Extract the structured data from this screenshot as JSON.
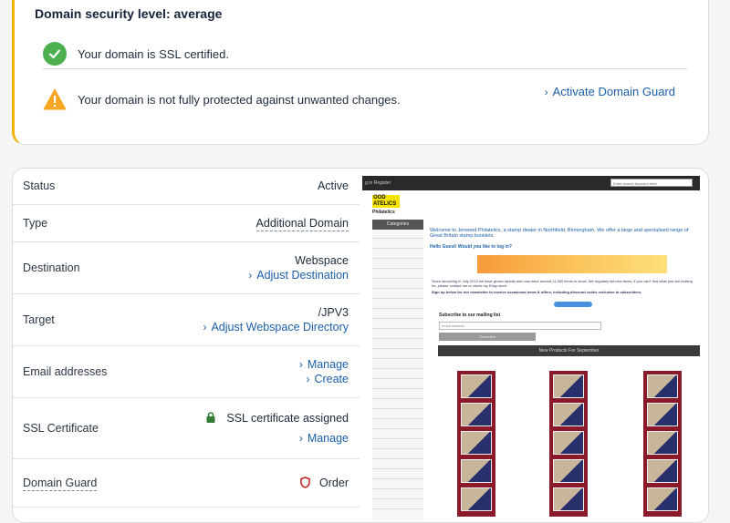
{
  "security": {
    "title": "Domain security level: average",
    "ssl_message": "Your domain is SSL certified.",
    "guard_message": "Your domain is not fully protected against unwanted changes.",
    "activate_link": "Activate Domain Guard",
    "ok_icon": "checkmark-circle-icon",
    "warn_icon": "warning-triangle-icon",
    "accent_color": "#f2b200",
    "ok_color": "#4caf50"
  },
  "details": {
    "status": {
      "label": "Status",
      "value": "Active"
    },
    "type": {
      "label": "Type",
      "value": "Additional Domain"
    },
    "destination": {
      "label": "Destination",
      "value": "Webspace",
      "action": "Adjust Destination"
    },
    "target": {
      "label": "Target",
      "value": "/JPV3",
      "action": "Adjust Webspace Directory"
    },
    "email": {
      "label": "Email addresses",
      "manage": "Manage",
      "create": "Create"
    },
    "ssl": {
      "label": "SSL Certificate",
      "value": "SSL certificate assigned",
      "manage": "Manage"
    },
    "guard": {
      "label": "Domain Guard",
      "action": "Order"
    }
  },
  "preview": {
    "top_text": "g to Register",
    "search_placeholder": "Enter search keyword here",
    "logo_line1": "OOD",
    "logo_line2": "ATELICS",
    "logo_sub": "Philatelics",
    "categories_label": "Categories",
    "welcome": "Welcome to Jerwood Philatelics, a stamp dealer in Northfield, Birmingham. We offer a large and specialised range of Great Britain stamp booklets.",
    "hello": "Hello Guest! Would you like to log in?",
    "since": "Since launching in July 2013 we have grown rapidly and now have around 11,000 items in stock. We regularly list new items, if you can't find what you are looking for, please contact me or check my Ebay store.",
    "signup": "Sign up below for our newsletter to receive occasional news & offers, including discount codes exclusive to subscribers.",
    "mailing": "Subscribe to our mailing list",
    "email_placeholder": "email address",
    "subscribe": "Subscribe",
    "new_products": "New Products For September",
    "link_color": "#1b5fa8"
  }
}
